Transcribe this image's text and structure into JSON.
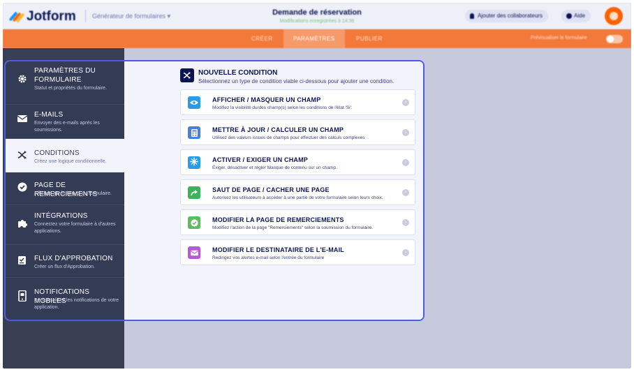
{
  "app": {
    "logo_text": "Jotform",
    "builder_label": "Générateur de formulaires",
    "form_title": "Demande de réservation",
    "form_subtitle": "Modifications enregistrées à 14:36",
    "collab_label": "Ajouter des collaborateurs",
    "help_label": "Aide"
  },
  "tabs": [
    {
      "label": "CRÉER"
    },
    {
      "label": "PARAMÈTRES"
    },
    {
      "label": "PUBLIER"
    }
  ],
  "preview_label": "Prévisualiser le formulaire",
  "menu": {
    "items": [
      {
        "title": "PARAMÈTRES DU FORMULAIRE",
        "desc": "Statut et propriétés du formulaire.",
        "icon": "gear-icon"
      },
      {
        "title": "E-MAILS",
        "desc": "Envoyer des e-mails après les soumissions.",
        "icon": "envelope-icon"
      },
      {
        "title": "CONDITIONS",
        "desc": "Créez une logique conditionnelle.",
        "icon": "shuffle-icon"
      },
      {
        "title": "PAGE DE REMERCIEMENTS",
        "desc": "Affichée après l'envoi du formulaire.",
        "icon": "check-circle-icon"
      },
      {
        "title": "INTÉGRATIONS",
        "desc": "Connectez votre formulaire à d'autres applications.",
        "icon": "puzzle-icon"
      },
      {
        "title": "FLUX D'APPROBATION",
        "desc": "Créer un flux d'Approbation.",
        "icon": "approval-icon"
      },
      {
        "title": "NOTIFICATIONS MOBILES",
        "desc": "Personnalisez les notifications de votre application.",
        "icon": "mobile-icon"
      }
    ]
  },
  "new_condition": {
    "title": "NOUVELLE CONDITION",
    "subtitle": "Sélectionnez un type de condition viable ci-dessous pour ajouter une condition."
  },
  "conditions": [
    {
      "title": "AFFICHER / MASQUER UN CHAMP",
      "desc": "Modifiez la visibilité du/des champ(s) selon les conditions de l'état 'Si'.",
      "icon": "eye-icon",
      "color": "#2b9be8"
    },
    {
      "title": "METTRE À JOUR / CALCULER UN CHAMP",
      "desc": "Utilisez des valeurs issues de champs pour effectuer des calculs complexes",
      "icon": "calculator-icon",
      "color": "#4a7de0"
    },
    {
      "title": "ACTIVER / EXIGER UN CHAMP",
      "desc": "Exiger, désactiver et régler Masque de contenu sur un champ.",
      "icon": "asterisk-icon",
      "color": "#2b9be8"
    },
    {
      "title": "SAUT DE PAGE / CACHER UNE PAGE",
      "desc": "Autorisez les utilisateurs à accéder à une partie de votre formulaire selon leurs choix.",
      "icon": "skip-arrow-icon",
      "color": "#3cb25b"
    },
    {
      "title": "MODIFIER LA PAGE DE REMERCIEMENTS",
      "desc": "Modifiez l'action de la page \"Remerciements\" selon la soumission du formulaire.",
      "icon": "check-circle-icon",
      "color": "#5fbb60"
    },
    {
      "title": "MODIFIER LE DESTINATAIRE DE L'E-MAIL",
      "desc": "Redirigez vos alertes e-mail selon l'entrée du formulaire",
      "icon": "envelope-icon",
      "color": "#b45bd1"
    }
  ]
}
